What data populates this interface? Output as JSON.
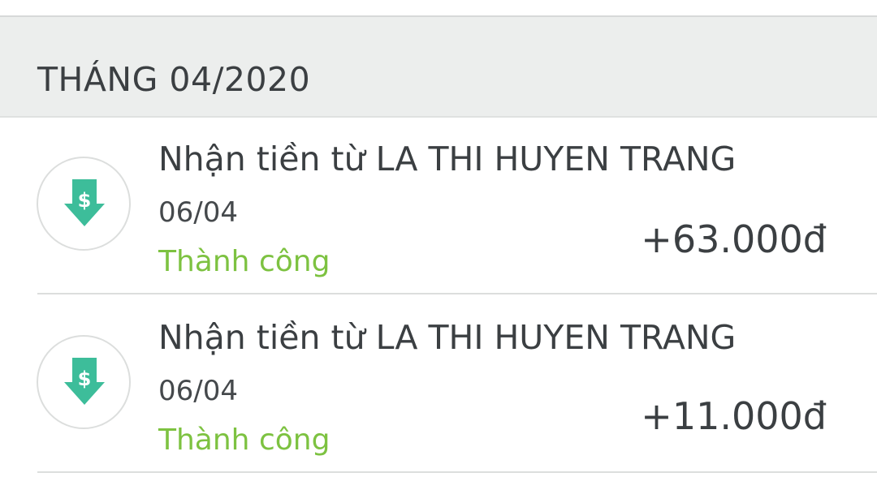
{
  "month_header": {
    "label": "THÁNG 04/2020"
  },
  "transactions": [
    {
      "title": "Nhận tiền từ LA THI HUYEN TRANG",
      "date": "06/04",
      "status": "Thành công",
      "amount": "+63.000đ",
      "icon": "money-receive-icon"
    },
    {
      "title": "Nhận tiền từ LA THI HUYEN TRANG",
      "date": "06/04",
      "status": "Thành công",
      "amount": "+11.000đ",
      "icon": "money-receive-icon"
    }
  ],
  "colors": {
    "accent_icon": "#3dbd9a",
    "status_success": "#7dc241",
    "header_bg": "#eceeed",
    "text_primary": "#3b3f42"
  }
}
